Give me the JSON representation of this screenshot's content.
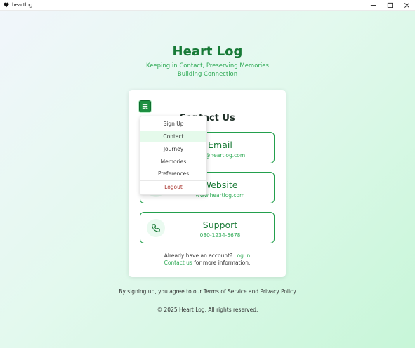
{
  "window": {
    "title": "heartlog",
    "app_icon": "heart-app-icon",
    "controls": [
      "minimize-icon",
      "maximize-icon",
      "close-icon"
    ]
  },
  "header": {
    "brand": "Heart Log",
    "tagline_line1": "Keeping in Contact, Preserving Memories",
    "tagline_line2": "Building Connection"
  },
  "card": {
    "menu_icon": "menu-toggle-icon",
    "heading": "Contact Us",
    "contacts": [
      {
        "icon": "mail-icon",
        "title": "Email",
        "value": "info@heartlog.com"
      },
      {
        "icon": "globe-icon",
        "title": "Website",
        "value": "www.heartlog.com"
      },
      {
        "icon": "phone-icon",
        "title": "Support",
        "value": "080-1234-5678"
      }
    ],
    "footer": {
      "account_text": "Already have an account?",
      "login_link": "Log In",
      "contact_link": "Contact us",
      "info_text": "for more information."
    }
  },
  "menu": {
    "items": [
      "Sign Up",
      "Contact",
      "Journey",
      "Memories",
      "Preferences"
    ],
    "active_item": "Contact",
    "logout": "Logout"
  },
  "legal": {
    "terms": "By signing up, you agree to our Terms of Service and Privacy Policy",
    "copyright": "© 2025 Heart Log. All rights reserved."
  },
  "colors": {
    "brand_green": "#187a37",
    "accent_green": "#2faa55",
    "button_green": "#1d8f41",
    "logout_red": "#a8332d"
  }
}
